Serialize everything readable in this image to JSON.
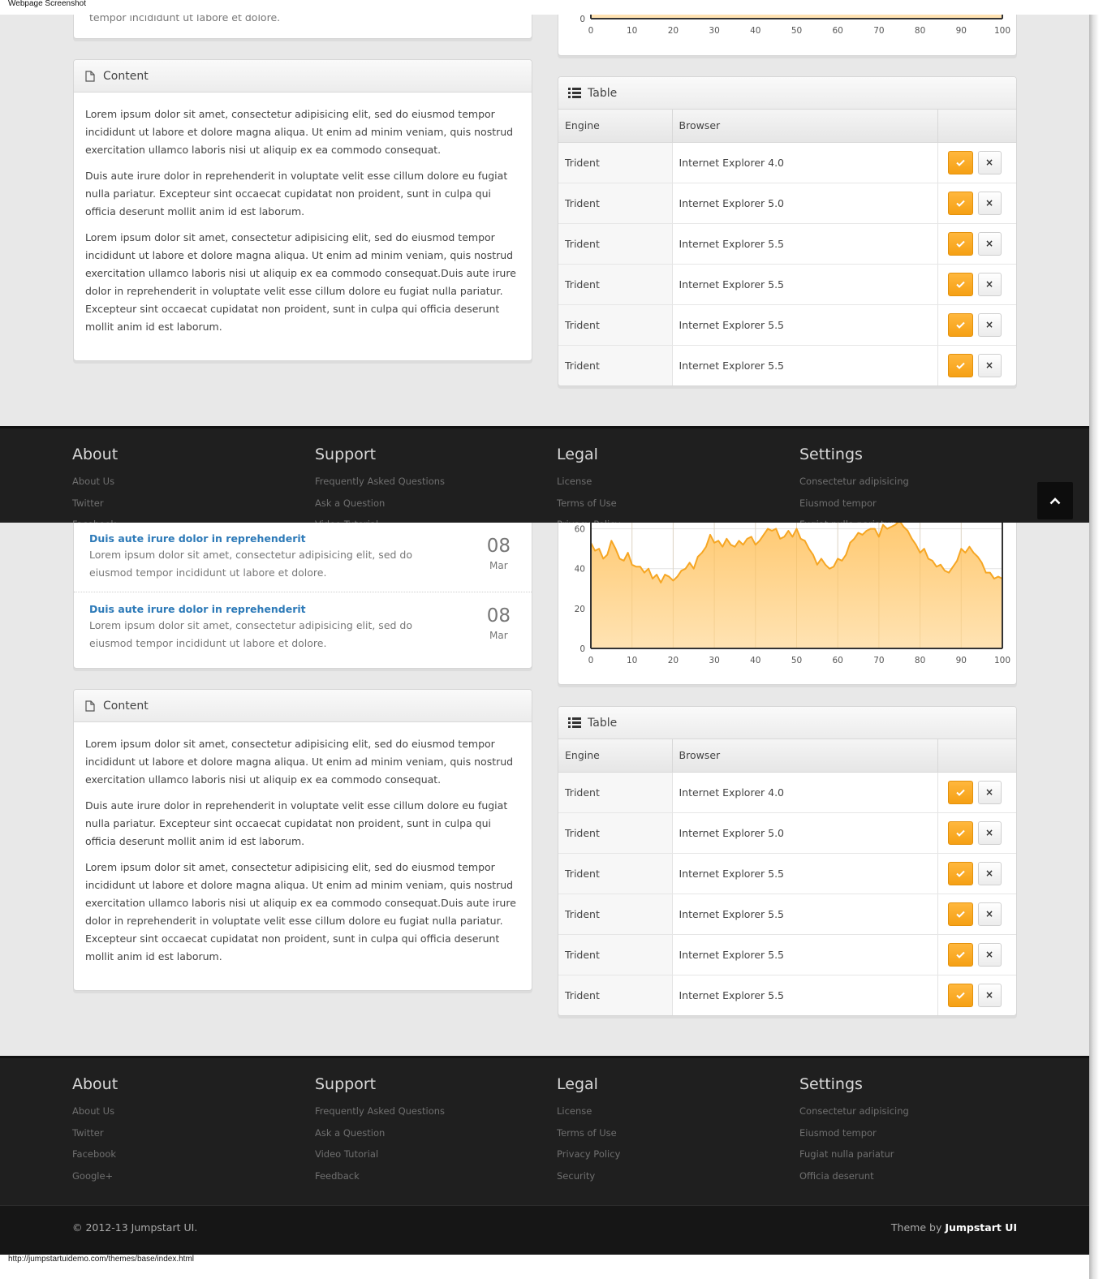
{
  "captions": {
    "top": "Webpage Screenshot",
    "bottom": "http://jumpstartuidemo.com/themes/base/index.html"
  },
  "news_tail": "tempor incididunt ut labore et dolore.",
  "content_widget": {
    "title": "Content",
    "paragraphs": [
      "Lorem ipsum dolor sit amet, consectetur adipisicing elit, sed do eiusmod tempor incididunt ut labore et dolore magna aliqua. Ut enim ad minim veniam, quis nostrud exercitation ullamco laboris nisi ut aliquip ex ea commodo consequat.",
      "Duis aute irure dolor in reprehenderit in voluptate velit esse cillum dolore eu fugiat nulla pariatur. Excepteur sint occaecat cupidatat non proident, sunt in culpa qui officia deserunt mollit anim id est laborum.",
      "Lorem ipsum dolor sit amet, consectetur adipisicing elit, sed do eiusmod tempor incididunt ut labore et dolore magna aliqua. Ut enim ad minim veniam, quis nostrud exercitation ullamco laboris nisi ut aliquip ex ea commodo consequat.Duis aute irure dolor in reprehenderit in voluptate velit esse cillum dolore eu fugiat nulla pariatur. Excepteur sint occaecat cupidatat non proident, sunt in culpa qui officia deserunt mollit anim id est laborum."
    ]
  },
  "news": [
    {
      "title": "Duis aute irure dolor in reprehenderit",
      "text": "Lorem ipsum dolor sit amet, consectetur adipisicing elit, sed do eiusmod tempor incididunt ut labore et dolore.",
      "day": "08",
      "month": "Mar"
    },
    {
      "title": "Duis aute irure dolor in reprehenderit",
      "text": "Lorem ipsum dolor sit amet, consectetur adipisicing elit, sed do eiusmod tempor incididunt ut labore et dolore.",
      "day": "08",
      "month": "Mar"
    }
  ],
  "table_widget": {
    "title": "Table",
    "headers": {
      "engine": "Engine",
      "browser": "Browser"
    },
    "rows": [
      {
        "engine": "Trident",
        "browser": "Internet Explorer 4.0"
      },
      {
        "engine": "Trident",
        "browser": "Internet Explorer 5.0"
      },
      {
        "engine": "Trident",
        "browser": "Internet Explorer 5.5"
      },
      {
        "engine": "Trident",
        "browser": "Internet Explorer 5.5"
      },
      {
        "engine": "Trident",
        "browser": "Internet Explorer 5.5"
      },
      {
        "engine": "Trident",
        "browser": "Internet Explorer 5.5"
      }
    ],
    "accept_glyph": "✓",
    "remove_glyph": "×"
  },
  "footer": {
    "columns": [
      {
        "title": "About",
        "links": [
          "About Us",
          "Twitter",
          "Facebook",
          "Google+"
        ]
      },
      {
        "title": "Support",
        "links": [
          "Frequently Asked Questions",
          "Ask a Question",
          "Video Tutorial",
          "Feedback"
        ]
      },
      {
        "title": "Legal",
        "links": [
          "License",
          "Terms of Use",
          "Privacy Policy",
          "Security"
        ]
      },
      {
        "title": "Settings",
        "links": [
          "Consectetur adipisicing",
          "Eiusmod tempor",
          "Fugiat nulla pariatur",
          "Officia deserunt"
        ]
      }
    ],
    "copyright": "© 2012-13 Jumpstart UI.",
    "theme_prefix": "Theme by ",
    "theme_brand": "Jumpstart UI"
  },
  "chart_data": {
    "type": "area",
    "color": "#f6a623",
    "fill_top": "#ffc971",
    "fill_bottom": "#ffe3b3",
    "xlim": [
      0,
      100
    ],
    "ylim": [
      0,
      70
    ],
    "x_ticks": [
      0,
      10,
      20,
      30,
      40,
      50,
      60,
      70,
      80,
      90,
      100
    ],
    "y_ticks": [
      0,
      20,
      40,
      60
    ],
    "x": [
      0,
      1,
      2,
      3,
      4,
      5,
      6,
      7,
      8,
      9,
      10,
      11,
      12,
      13,
      14,
      15,
      16,
      17,
      18,
      19,
      20,
      21,
      22,
      23,
      24,
      25,
      26,
      27,
      28,
      29,
      30,
      31,
      32,
      33,
      34,
      35,
      36,
      37,
      38,
      39,
      40,
      41,
      42,
      43,
      44,
      45,
      46,
      47,
      48,
      49,
      50,
      51,
      52,
      53,
      54,
      55,
      56,
      57,
      58,
      59,
      60,
      61,
      62,
      63,
      64,
      65,
      66,
      67,
      68,
      69,
      70,
      71,
      72,
      73,
      74,
      75,
      76,
      77,
      78,
      79,
      80,
      81,
      82,
      83,
      84,
      85,
      86,
      87,
      88,
      89,
      90,
      91,
      92,
      93,
      94,
      95,
      96,
      97,
      98,
      99,
      100
    ],
    "y": [
      53,
      49,
      50,
      45,
      47,
      54,
      50,
      45,
      44,
      48,
      42,
      41,
      41,
      38,
      40,
      35,
      37,
      33,
      37,
      36,
      34,
      36,
      39,
      40,
      43,
      40,
      46,
      48,
      51,
      57,
      53,
      54,
      51,
      55,
      52,
      51,
      54,
      52,
      55,
      56,
      52,
      54,
      57,
      60,
      59,
      60,
      55,
      56,
      59,
      56,
      60,
      55,
      54,
      50,
      47,
      42,
      45,
      42,
      40,
      41,
      45,
      44,
      47,
      53,
      55,
      58,
      57,
      59,
      60,
      60,
      56,
      62,
      60,
      61,
      62,
      64,
      61,
      59,
      55,
      52,
      48,
      50,
      45,
      44,
      41,
      42,
      39,
      38,
      41,
      44,
      50,
      48,
      51,
      48,
      46,
      43,
      38,
      38,
      35,
      36,
      35
    ],
    "partial": {
      "last_visible_ticks": [
        "0",
        "10",
        "20",
        "30",
        "40",
        "50",
        "60",
        "70",
        "80",
        "90",
        "100"
      ]
    }
  }
}
